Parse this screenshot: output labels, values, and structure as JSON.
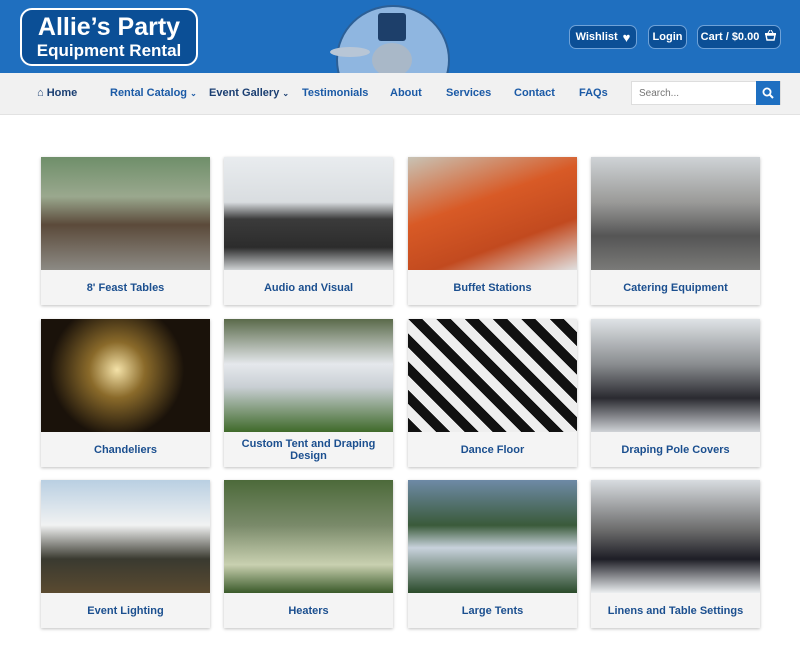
{
  "header": {
    "logo_line1": "Allie’s Party",
    "logo_line2": "Equipment Rental",
    "wishlist_label": "Wishlist",
    "login_label": "Login",
    "cart_label": "Cart / $0.00",
    "colors": {
      "header_bg": "#1f6fbf",
      "button_bg": "#0b4f96"
    }
  },
  "nav": {
    "items": [
      {
        "label": "Home",
        "icon": "home-icon"
      },
      {
        "label": "Rental Catalog",
        "dropdown": true
      },
      {
        "label": "Event Gallery",
        "dropdown": true
      },
      {
        "label": "Testimonials"
      },
      {
        "label": "About"
      },
      {
        "label": "Services"
      },
      {
        "label": "Contact"
      },
      {
        "label": "FAQs"
      }
    ],
    "search_placeholder": "Search..."
  },
  "gallery": [
    {
      "label": "8' Feast Tables"
    },
    {
      "label": "Audio and Visual"
    },
    {
      "label": "Buffet Stations"
    },
    {
      "label": "Catering Equipment"
    },
    {
      "label": "Chandeliers"
    },
    {
      "label": "Custom Tent and Draping Design"
    },
    {
      "label": "Dance Floor"
    },
    {
      "label": "Draping Pole Covers"
    },
    {
      "label": "Event Lighting"
    },
    {
      "label": "Heaters"
    },
    {
      "label": "Large Tents"
    },
    {
      "label": "Linens and Table Settings"
    }
  ]
}
